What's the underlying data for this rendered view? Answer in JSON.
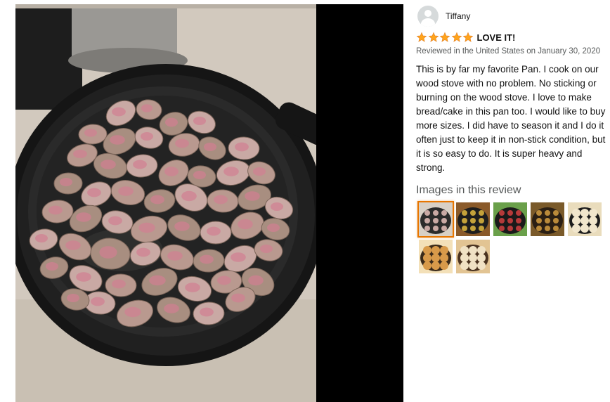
{
  "reviewer": {
    "name": "Tiffany",
    "avatar_icon": "default-avatar-icon"
  },
  "review": {
    "stars": 5,
    "star_color": "#ffa41c",
    "title": "LOVE IT!",
    "meta": "Reviewed in the United States on January 30, 2020",
    "body": "This is by far my favorite Pan. I cook on our wood stove with no problem. No sticking or burning on the wood stove. I love to make bread/cake in this pan too. I would like to buy more sizes. I did have to season it and I do it often just to keep it in non-stick condition, but it is so easy to do. It is super heavy and strong."
  },
  "images_section": {
    "heading": "Images in this review",
    "selected_index": 0,
    "thumbnails": [
      {
        "subject": "browned meat chunks in cast iron skillet"
      },
      {
        "subject": "vegetables in skillet on stove"
      },
      {
        "subject": "colorful vegetables in skillet"
      },
      {
        "subject": "stew in skillet"
      },
      {
        "subject": "dough balls in skillet"
      },
      {
        "subject": "baked rolls on rack"
      },
      {
        "subject": "baked rolls close up"
      }
    ]
  },
  "colors": {
    "selection_outline": "#e77600",
    "meta_text": "#565959",
    "viewer_background": "#000000"
  }
}
